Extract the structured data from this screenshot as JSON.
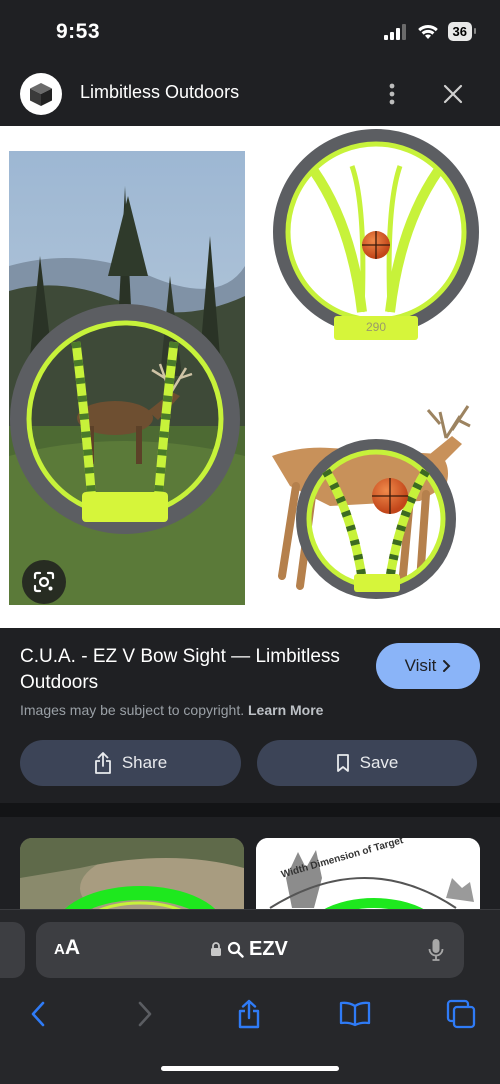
{
  "status_bar": {
    "time": "9:53",
    "battery": "36",
    "icons": [
      "cellular-signal-icon",
      "wifi-icon",
      "battery-icon"
    ]
  },
  "source": {
    "site_name": "Limbitless Outdoors",
    "icons": [
      "cube-logo-icon",
      "more-vertical-icon",
      "close-icon"
    ]
  },
  "result": {
    "title": "C.U.A. - EZ V Bow Sight — Limbitless Outdoors",
    "visit_label": "Visit",
    "copyright_text": "Images may be subject to copyright.",
    "learn_more": "Learn More",
    "share_label": "Share",
    "save_label": "Save"
  },
  "image": {
    "sight_label": "290"
  },
  "related": {
    "thumb2_text": "Width Dimension of Target"
  },
  "browser": {
    "aa_small": "A",
    "aa_large": "A",
    "url": "EZV",
    "toolbar": [
      "back-icon",
      "forward-icon",
      "share-icon",
      "bookmarks-icon",
      "tabs-icon"
    ]
  },
  "colors": {
    "background": "#1f2023",
    "accent": "#8ab4f8",
    "pill_button": "#3c4457",
    "ios_blue": "#2f7bf6",
    "sight_green": "#c7f23a",
    "sight_ring": "#5c5e62"
  }
}
